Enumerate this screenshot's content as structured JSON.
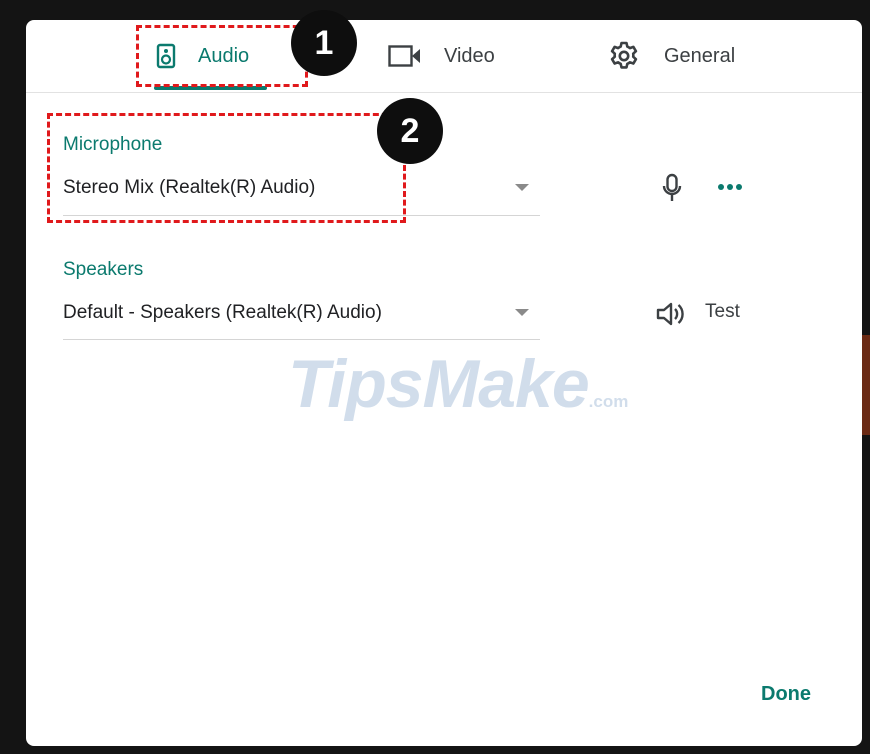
{
  "tabs": [
    {
      "label": "Audio",
      "icon": "speaker-icon",
      "active": true
    },
    {
      "label": "Video",
      "icon": "video-camera-icon",
      "active": false
    },
    {
      "label": "General",
      "icon": "gear-icon",
      "active": false
    }
  ],
  "annotations": {
    "badge_1": "1",
    "badge_2": "2"
  },
  "microphone": {
    "label": "Microphone",
    "value": "Stereo Mix (Realtek(R) Audio)",
    "icon": "microphone-icon",
    "more_icon": "more-options-icon"
  },
  "speakers": {
    "label": "Speakers",
    "value": "Default - Speakers (Realtek(R) Audio)",
    "icon": "speaker-volume-icon",
    "test_label": "Test"
  },
  "watermark": {
    "main": "TipsMake",
    "suffix": ".com"
  },
  "footer": {
    "done_label": "Done"
  },
  "colors": {
    "accent": "#0b7a6e",
    "annotation": "#e0191c",
    "background": "#141414"
  }
}
